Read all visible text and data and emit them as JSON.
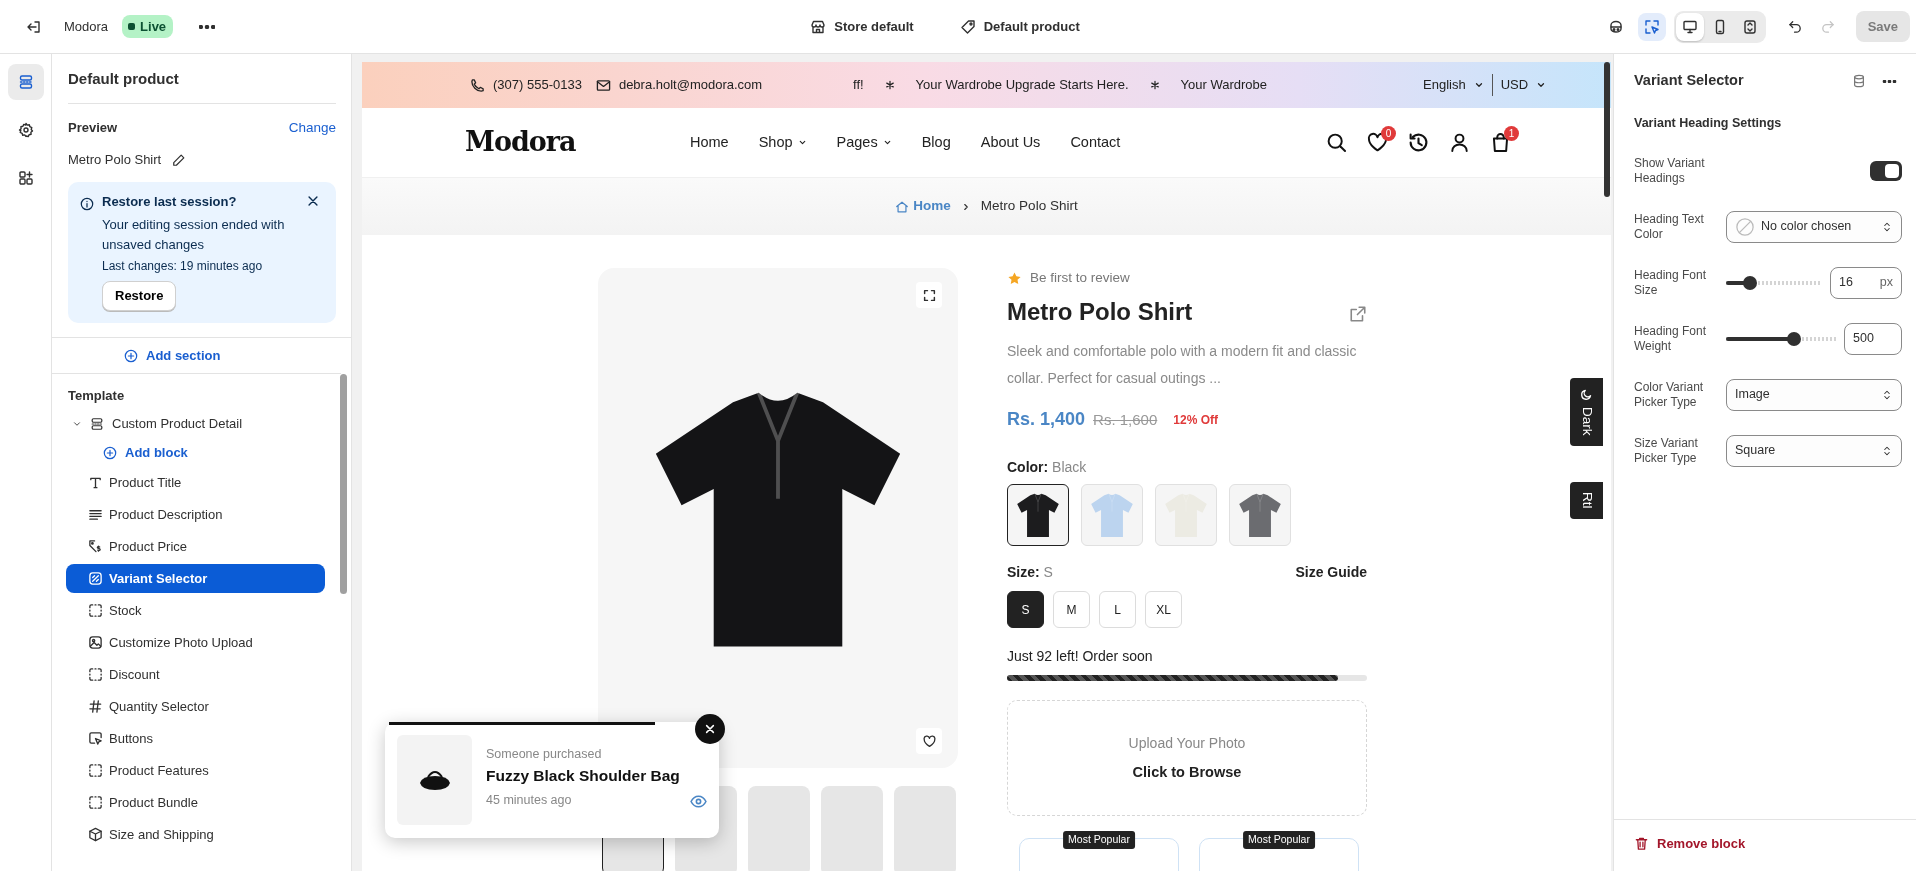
{
  "topbar": {
    "app_name": "Modora",
    "status": "Live",
    "center_links": [
      {
        "label": "Store default",
        "kind": "store"
      },
      {
        "label": "Default product",
        "kind": "tag"
      }
    ],
    "select_tool": {
      "selected": true
    },
    "view_modes": [
      {
        "kind": "desktop",
        "selected": true
      },
      {
        "kind": "mobile",
        "selected": false
      },
      {
        "kind": "fullscreen",
        "selected": false
      }
    ],
    "undo": {
      "disabled": false
    },
    "redo": {
      "disabled": true
    },
    "save": {
      "label": "Save",
      "disabled": true
    }
  },
  "rail": [
    {
      "kind": "sections",
      "selected": true
    },
    {
      "kind": "settings",
      "selected": false
    },
    {
      "kind": "apps",
      "selected": false
    }
  ],
  "sidebar": {
    "title": "Default product",
    "preview_label": "Preview",
    "change_link": "Change",
    "preview_product": "Metro Polo Shirt",
    "notice": {
      "title": "Restore last session?",
      "message": "Your editing session ended with unsaved changes",
      "detail": "Last changes: 19 minutes ago",
      "button": "Restore"
    },
    "add_section": "Add section",
    "template_label": "Template",
    "section": {
      "label": "Custom Product Detail",
      "expanded": true,
      "add_block": "Add block",
      "blocks": [
        {
          "label": "Product Title",
          "kind": "title",
          "selected": false
        },
        {
          "label": "Product Description",
          "kind": "description",
          "selected": false
        },
        {
          "label": "Product Price",
          "kind": "price",
          "selected": false
        },
        {
          "label": "Variant Selector",
          "kind": "variant",
          "selected": true
        },
        {
          "label": "Stock",
          "kind": "placeholder",
          "selected": false
        },
        {
          "label": "Customize Photo Upload",
          "kind": "photo",
          "selected": false
        },
        {
          "label": "Discount",
          "kind": "placeholder",
          "selected": false
        },
        {
          "label": "Quantity Selector",
          "kind": "quantity",
          "selected": false
        },
        {
          "label": "Buttons",
          "kind": "buttons",
          "selected": false
        },
        {
          "label": "Product Features",
          "kind": "placeholder",
          "selected": false
        },
        {
          "label": "Product Bundle",
          "kind": "placeholder",
          "selected": false
        },
        {
          "label": "Size and Shipping",
          "kind": "shipping",
          "selected": false
        }
      ]
    }
  },
  "store": {
    "phone": "(307) 555-0133",
    "email": "debra.holt@modora.com",
    "marquee": [
      "ff!",
      "Your Wardrobe Upgrade Starts Here.",
      "Your Wardrobe"
    ],
    "language": "English",
    "currency": "USD",
    "logo": "Modora",
    "nav": [
      {
        "label": "Home",
        "has_menu": false
      },
      {
        "label": "Shop",
        "has_menu": true
      },
      {
        "label": "Pages",
        "has_menu": true
      },
      {
        "label": "Blog",
        "has_menu": false
      },
      {
        "label": "About Us",
        "has_menu": false
      },
      {
        "label": "Contact",
        "has_menu": false
      }
    ],
    "wishlist_count": "0",
    "cart_count": "1",
    "breadcrumb": [
      "Home",
      "Metro Polo Shirt"
    ],
    "thumbnails": [
      {
        "selected": true
      },
      {
        "selected": false
      },
      {
        "selected": false
      },
      {
        "selected": false
      },
      {
        "selected": false
      }
    ],
    "product": {
      "review": "Be first to review",
      "title": "Metro Polo Shirt",
      "description": "Sleek and comfortable polo with a modern fit and classic collar. Perfect for casual outings ...",
      "price": "Rs. 1,400",
      "old_price": "Rs. 1,600",
      "discount": "12% Off",
      "color_label": "Color:",
      "color_value": "Black",
      "swatches": [
        {
          "color": "#1c1c1e",
          "selected": true
        },
        {
          "color": "#bcd4ef",
          "selected": false
        },
        {
          "color": "#ecebe3",
          "selected": false
        },
        {
          "color": "#6b6c70",
          "selected": false
        }
      ],
      "size_label": "Size:",
      "size_value": "S",
      "size_guide": "Size Guide",
      "sizes": [
        {
          "label": "S",
          "selected": true
        },
        {
          "label": "M",
          "selected": false
        },
        {
          "label": "L",
          "selected": false
        },
        {
          "label": "XL",
          "selected": false
        }
      ],
      "stock": {
        "text": "Just 92 left! Order soon",
        "level": 0.92
      },
      "upload": {
        "title": "Upload Your Photo",
        "action": "Click to Browse"
      }
    },
    "plans": [
      {
        "badge": "Most Popular"
      },
      {
        "badge": "Most Popular"
      }
    ],
    "popup": {
      "label": "Someone purchased",
      "product": "Fuzzy Black Shoulder Bag",
      "time": "45 minutes ago"
    },
    "side_tabs": [
      {
        "label": "Dark",
        "kind": "dark"
      },
      {
        "label": "Rtl",
        "kind": "rtl"
      }
    ]
  },
  "inspector": {
    "title": "Variant Selector",
    "heading": "Variant Heading Settings",
    "settings": [
      {
        "kind": "toggle",
        "label": "Show Variant Headings",
        "on": true
      },
      {
        "kind": "color",
        "label": "Heading Text Color",
        "value": "No color chosen"
      },
      {
        "kind": "slider",
        "label": "Heading Font Size",
        "level": 0.25,
        "value": "16",
        "unit": "px"
      },
      {
        "kind": "slider",
        "label": "Heading Font Weight",
        "level": 0.62,
        "value": "500"
      },
      {
        "kind": "select",
        "label": "Color Variant Picker Type",
        "value": "Image"
      },
      {
        "kind": "select",
        "label": "Size Variant Picker Type",
        "value": "Square"
      }
    ],
    "remove": "Remove block"
  }
}
